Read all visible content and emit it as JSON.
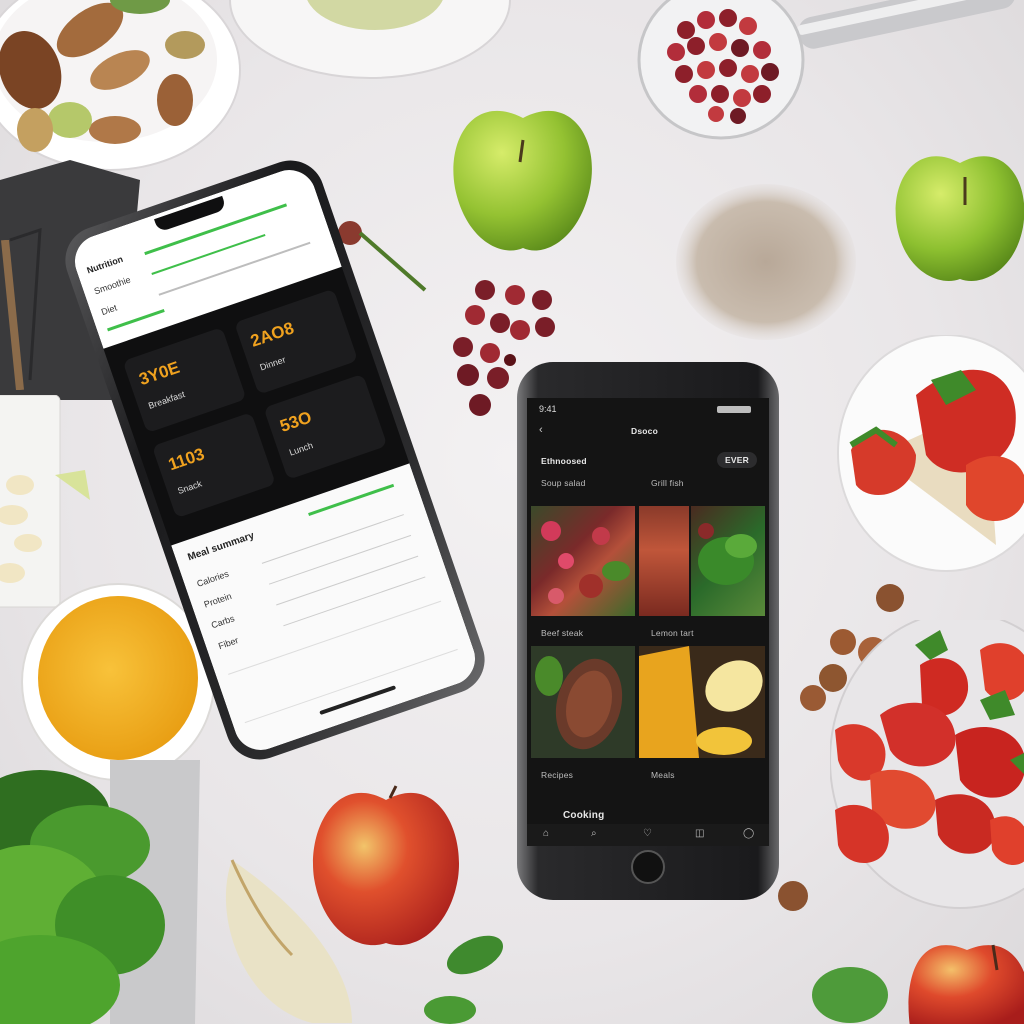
{
  "colors": {
    "background": "#ebe8ea",
    "phone_frame": "#1c1c1e",
    "screen_dark": "#141414",
    "accent_orange": "#f0a21f",
    "accent_green": "#3fbf4a"
  },
  "phone_left": {
    "header_lines": [
      "Nutrition",
      "Smoothie",
      "Diet"
    ],
    "card_values": [
      "3Y0E",
      "2AO8",
      "1103",
      "53O"
    ],
    "card_sublabels": [
      "Breakfast",
      "Dinner",
      "Snack",
      "Lunch"
    ],
    "bottom_table_title": "Meal summary",
    "bottom_rows": [
      "Calories",
      "Protein",
      "Carbs",
      "Fiber"
    ]
  },
  "phone_right": {
    "status_time": "9:41",
    "title": "Dsoco",
    "section_label": "Ethnoosed",
    "section_button": "EVER",
    "row1_labels": [
      "Soup salad",
      "Grill fish"
    ],
    "row2_labels": [
      "Beef steak",
      "Lemon tart"
    ],
    "bottom_labels": [
      "Recipes",
      "Meals"
    ],
    "bottom_caption": "Cooking",
    "tab_icons": [
      "home-icon",
      "search-icon",
      "heart-icon",
      "cart-icon",
      "profile-icon"
    ]
  }
}
